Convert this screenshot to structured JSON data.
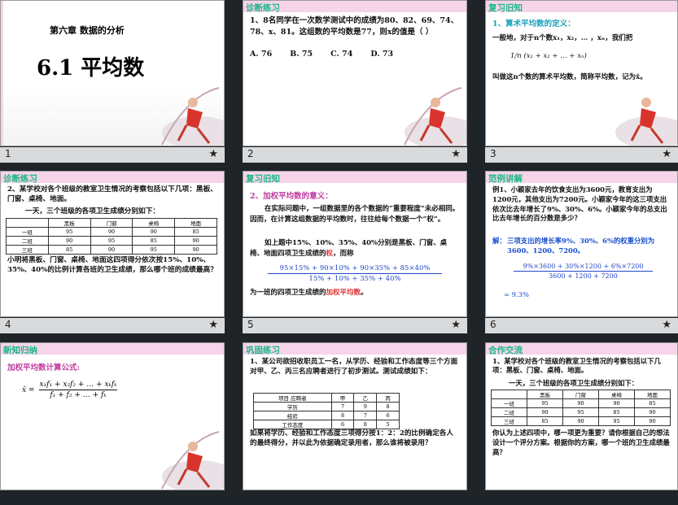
{
  "slides": [
    {
      "number": "1",
      "chapter": "第六章  数据的分析",
      "title": "6.1  平均数"
    },
    {
      "number": "2",
      "tag": "诊断练习",
      "q": "1、8名同学在一次数学测试中的成绩为80、82、69、74、78、x、81。这组数的平均数是77，则x的值是（    ）",
      "opts": [
        "A. 76",
        "B. 75",
        "C. 74",
        "D. 73"
      ]
    },
    {
      "number": "3",
      "tag": "复习旧知",
      "heading": "1、算术平均数的定义：",
      "line1": "一般地，对于n个数x₁，x₂，… ，xₙ，我们把",
      "formula": "1/n (x₁ + x₂ + … + xₙ)",
      "line2": "叫做这n个数的算术平均数，简称平均数，记为x̄。"
    },
    {
      "number": "4",
      "tag": "诊断练习",
      "q1": "2、某学校对各个班级的教室卫生情况的考察包括以下几项：黑板、门窗、桌椅、地面。",
      "q2": "一天，三个班级的各项卫生成绩分别如下：",
      "head": [
        "",
        "黑板",
        "门窗",
        "桌椅",
        "地面"
      ],
      "rows": [
        [
          "一班",
          "95",
          "90",
          "90",
          "85"
        ],
        [
          "二班",
          "90",
          "95",
          "85",
          "90"
        ],
        [
          "三班",
          "85",
          "90",
          "95",
          "90"
        ]
      ],
      "q3": "小明将黑板、门窗、桌椅、地面这四项得分依次按15%、10%、35%、40%的比例计算各班的卫生成绩，那么哪个班的成绩最高？"
    },
    {
      "number": "5",
      "tag": "复习旧知",
      "heading": "2、加权平均数的意义：",
      "p1": "在实际问题中，一组数据里的各个数据的“重要程度”未必相同。因而，在计算这组数据的平均数时，往往给每个数据一个“权”。",
      "p2a": "如上题中15%、10%、35%、40%分别是黑板、门窗、桌椅、地面四项卫生成绩的",
      "p2b": "权",
      "p2c": "，而称",
      "num": "95×15% + 90×10% + 90×35% + 85×40%",
      "den": "15% + 10% + 35% + 40%",
      "p3a": "为一班的四项卫生成绩的",
      "p3b": "加权平均数",
      "p3c": "。"
    },
    {
      "number": "6",
      "tag": "范例讲解",
      "q": "例1、小颖家去年的饮食支出为3600元，教育支出为1200元，其他支出为7200元。小颖家今年的这三项支出依次比去年增长了9%、30%、6%。小颖家今年的总支出比去年增长的百分数是多少？",
      "sol_label": "解：",
      "sol": "三项支出的增长率9%、30%、6%的权重分别为3600、1200、7200。",
      "num": "9%×3600 + 30%×1200 + 6%×7200",
      "den": "3600 + 1200 + 7200",
      "result": "= 9.3%"
    },
    {
      "number": "",
      "tag": "新知归纳",
      "heading": "加权平均数计算公式:",
      "lhs": "x̄ =",
      "num": "x₁f₁ + x₂f₂ + … + xₖfₖ",
      "den": "f₁ + f₂ + … + fₖ"
    },
    {
      "number": "",
      "tag": "巩固练习",
      "q": "1、某公司欲招收职员工一名，从学历、经验和工作态度等三个方面对甲、乙、丙三名应聘者进行了初步测试。测试成绩如下：",
      "head": [
        "项目  应聘者",
        "甲",
        "乙",
        "丙"
      ],
      "rows": [
        [
          "学历",
          "7",
          "9",
          "8"
        ],
        [
          "经验",
          "8",
          "7",
          "6"
        ],
        [
          "工作态度",
          "6",
          "8",
          "5"
        ]
      ],
      "q2": "如果将学历、经验和工作态度三项得分按1：2：2的比例确定各人的最终得分，并以此为依据确定录用者，那么谁将被录用？"
    },
    {
      "number": "",
      "tag": "合作交流",
      "q1": "1、某学校对各个班级的教室卫生情况的考察包括以下几项：黑板、门窗、桌椅、地面。",
      "q2": "一天，三个班级的各项卫生成绩分别如下：",
      "head": [
        "",
        "黑板",
        "门窗",
        "桌椅",
        "地面"
      ],
      "rows": [
        [
          "一班",
          "95",
          "90",
          "90",
          "85"
        ],
        [
          "二班",
          "90",
          "95",
          "85",
          "90"
        ],
        [
          "三班",
          "85",
          "90",
          "95",
          "90"
        ]
      ],
      "q3": "你认为上述四项中，哪一项更为重要？请你根据自己的想法设计一个评分方案。根据你的方案，哪一个班的卫生成绩最高？"
    }
  ],
  "star_glyph": "★",
  "colors": {
    "tag": "#19b884",
    "pink": "#f6d4ea",
    "formula": "#2247c9",
    "accent_red": "#e03030"
  }
}
